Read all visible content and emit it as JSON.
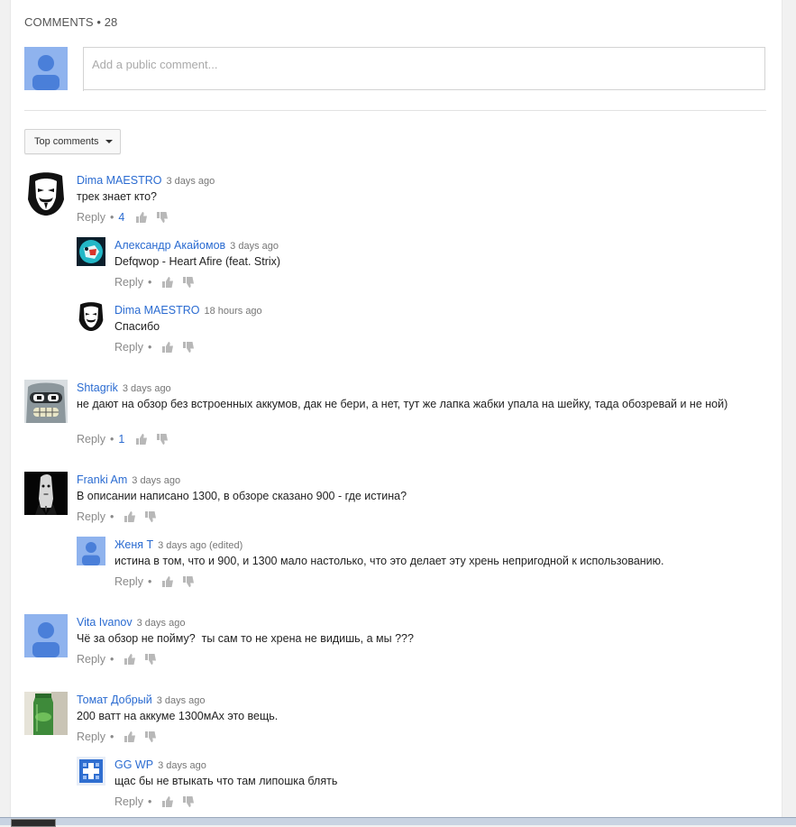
{
  "header": {
    "title": "COMMENTS • 28"
  },
  "compose": {
    "placeholder": "Add a public comment..."
  },
  "sort": {
    "label": "Top comments"
  },
  "comments": [
    {
      "author": "Dima MAESTRO",
      "time": "3 days ago",
      "text": "трек знает кто?",
      "reply": "Reply",
      "likes": "4",
      "replies": [
        {
          "author": "Александр Акайомов",
          "time": "3 days ago",
          "text": "Defqwop - Heart Afire (feat. Strix)",
          "reply": "Reply"
        },
        {
          "author": "Dima MAESTRO",
          "time": "18 hours ago",
          "text": "Спасибо",
          "reply": "Reply"
        }
      ]
    },
    {
      "author": "Shtagrik",
      "time": "3 days ago",
      "text": "не дают на обзор без встроенных аккумов, дак не бери, а нет, тут же лапка жабки упала на шейку, тада обозревай и не ной)",
      "reply": "Reply",
      "likes": "1"
    },
    {
      "author": "Franki Am",
      "time": "3 days ago",
      "text": "В описании написано 1300, в обзоре сказано 900 - где истина?",
      "reply": "Reply",
      "replies": [
        {
          "author": "Женя Т",
          "time": "3 days ago (edited)",
          "text": "истина в том, что и 900, и 1300 мало настолько, что это делает эту хрень непригодной к использованию.",
          "reply": "Reply"
        }
      ]
    },
    {
      "author": "Vita Ivanov",
      "time": "3 days ago",
      "text": "Чё за обзор не пойму?  ты сам то не хрена не видишь, а мы ???",
      "reply": "Reply"
    },
    {
      "author": "Томат Добрый",
      "time": "3 days ago",
      "text": "200 ватт на аккуме 1300мАх это вещь.",
      "reply": "Reply",
      "replies": [
        {
          "author": "GG WP",
          "time": "3 days ago",
          "text": "щас бы не втыкать что там липошка блять",
          "reply": "Reply"
        }
      ]
    }
  ],
  "colors": {
    "link": "#2a6bd1",
    "default_avatar_bg": "#8fb3ee",
    "default_avatar_fg": "#4a7fd9"
  }
}
